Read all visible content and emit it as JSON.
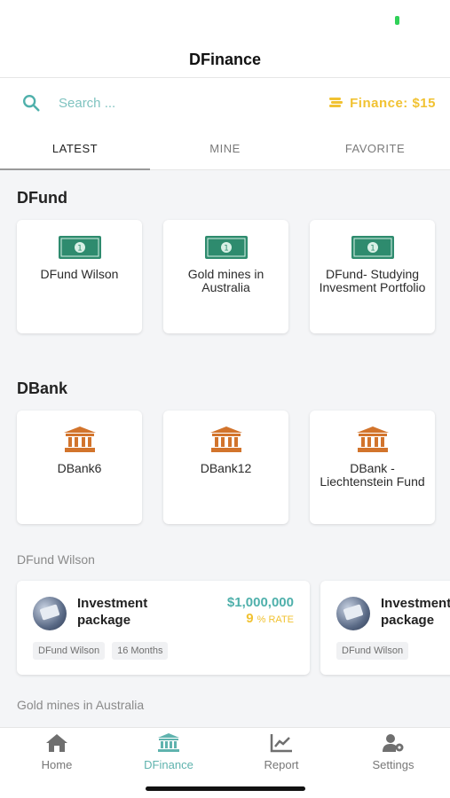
{
  "app": {
    "title": "DFinance"
  },
  "search": {
    "placeholder": "Search ...",
    "icon": "search-icon"
  },
  "finance_badge": {
    "label": "Finance: $15",
    "icon": "coins-icon",
    "color": "#f1c232"
  },
  "tabs": [
    {
      "label": "LATEST",
      "active": true
    },
    {
      "label": "MINE",
      "active": false
    },
    {
      "label": "FAVORITE",
      "active": false
    }
  ],
  "sections": {
    "dfund": {
      "title": "DFund",
      "icon": "money-icon",
      "icon_color": "#2e8b6e",
      "items": [
        {
          "label": "DFund Wilson"
        },
        {
          "label": "Gold mines in Australia"
        },
        {
          "label": "DFund- Studying Invesment Portfolio"
        }
      ]
    },
    "dbank": {
      "title": "DBank",
      "icon": "bank-icon",
      "icon_color": "#d2742c",
      "items": [
        {
          "label": "DBank6"
        },
        {
          "label": "DBank12"
        },
        {
          "label": "DBank - Liechtenstein Fund"
        }
      ]
    }
  },
  "packages": {
    "group_title": "DFund Wilson",
    "items": [
      {
        "title": "Investment package",
        "amount": "$1,000,000",
        "rate_value": "9",
        "rate_label": "% RATE",
        "tags": [
          "DFund Wilson",
          "16 Months"
        ]
      },
      {
        "title": "Investment package",
        "tags": [
          "DFund Wilson"
        ]
      }
    ],
    "next_group_title": "Gold mines in Australia"
  },
  "nav": [
    {
      "label": "Home",
      "icon": "home-icon",
      "active": false
    },
    {
      "label": "DFinance",
      "icon": "bank-icon",
      "active": true
    },
    {
      "label": "Report",
      "icon": "chart-icon",
      "active": false
    },
    {
      "label": "Settings",
      "icon": "user-settings-icon",
      "active": false
    }
  ],
  "colors": {
    "accent": "#5fb3ae",
    "gold": "#f1c232",
    "background": "#f4f5f7"
  }
}
